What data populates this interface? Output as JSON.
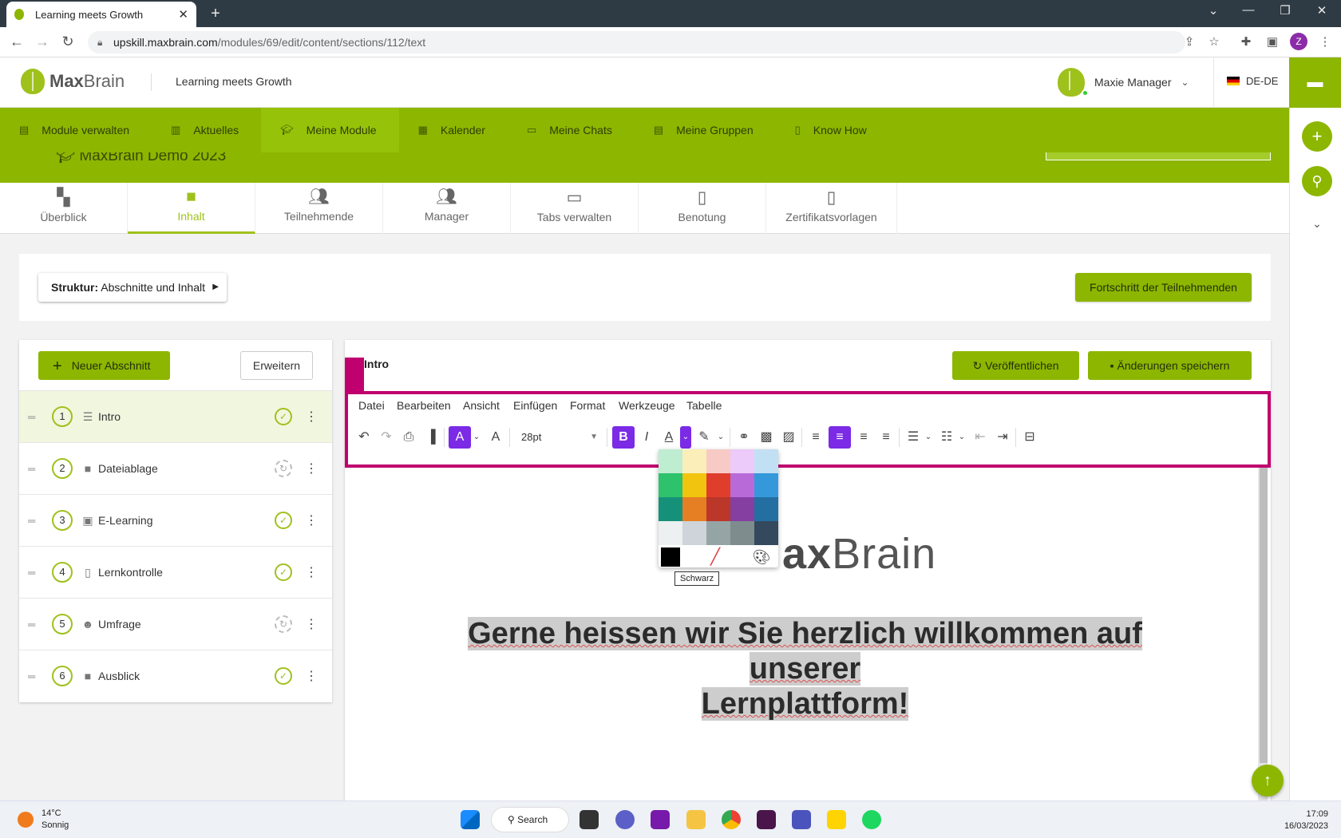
{
  "browser": {
    "tab_title": "Learning meets Growth",
    "url_host": "upskill.maxbrain.com",
    "url_path": "/modules/69/edit/content/sections/112/text",
    "profile_initial": "Z"
  },
  "header": {
    "logo_bold": "Max",
    "logo_light": "Brain",
    "tagline": "Learning meets Growth",
    "user_name": "Maxie Manager",
    "language": "DE-DE"
  },
  "mainnav": [
    {
      "label": "Module verwalten",
      "icon": "folder-icon"
    },
    {
      "label": "Aktuelles",
      "icon": "news-icon"
    },
    {
      "label": "Meine Module",
      "icon": "graduation-cap-icon",
      "active": true
    },
    {
      "label": "Kalender",
      "icon": "calendar-icon"
    },
    {
      "label": "Meine Chats",
      "icon": "chat-icon"
    },
    {
      "label": "Meine Gruppen",
      "icon": "group-icon"
    },
    {
      "label": "Know How",
      "icon": "book-icon"
    }
  ],
  "module_title": "MaxBrain Demo 2023",
  "module_tabs": [
    {
      "label": "Überblick",
      "icon": "dashboard-icon"
    },
    {
      "label": "Inhalt",
      "icon": "folder-icon",
      "active": true
    },
    {
      "label": "Teilnehmende",
      "icon": "people-icon"
    },
    {
      "label": "Manager",
      "icon": "manager-icon"
    },
    {
      "label": "Tabs verwalten",
      "icon": "window-icon"
    },
    {
      "label": "Benotung",
      "icon": "grade-icon"
    },
    {
      "label": "Zertifikatsvorlagen",
      "icon": "certificate-icon"
    }
  ],
  "structure": {
    "label": "Struktur:",
    "value": "Abschnitte und Inhalt"
  },
  "progress_button": "Fortschritt der Teilnehmenden",
  "sections_panel": {
    "new_button": "Neuer Abschnitt",
    "expand_button": "Erweitern",
    "items": [
      {
        "num": "1",
        "label": "Intro",
        "icon": "text-lines-icon",
        "status": "published",
        "active": true
      },
      {
        "num": "2",
        "label": "Dateiablage",
        "icon": "folder-icon",
        "status": "pending"
      },
      {
        "num": "3",
        "label": "E-Learning",
        "icon": "elearning-icon",
        "status": "published"
      },
      {
        "num": "4",
        "label": "Lernkontrolle",
        "icon": "quiz-icon",
        "status": "published"
      },
      {
        "num": "5",
        "label": "Umfrage",
        "icon": "survey-icon",
        "status": "pending"
      },
      {
        "num": "6",
        "label": "Ausblick",
        "icon": "folder-icon",
        "status": "published"
      }
    ]
  },
  "editor": {
    "section_title": "Intro",
    "publish_button": "Veröffentlichen",
    "save_button": "Änderungen speichern",
    "menu": [
      "Datei",
      "Bearbeiten",
      "Ansicht",
      "Einfügen",
      "Format",
      "Werkzeuge",
      "Tabelle"
    ],
    "font_size": "28pt",
    "logo_text_bold": "ax",
    "logo_text_light": "Brain",
    "content_line1": "Gerne heissen wir Sie herzlich willkommen auf unserer",
    "content_line2": "Lernplattform!"
  },
  "color_picker": {
    "tooltip": "Schwarz",
    "rows": [
      [
        "#bfedd2",
        "#fbeeb8",
        "#f8cac6",
        "#eccafa",
        "#c2e0f4"
      ],
      [
        "#2dc26b",
        "#f1c40f",
        "#e03e2d",
        "#b96ad9",
        "#3598db"
      ],
      [
        "#169179",
        "#e67e23",
        "#ba372a",
        "#843fa1",
        "#236fa1"
      ],
      [
        "#ecf0f1",
        "#ced4d9",
        "#95a5a6",
        "#7e8c8d",
        "#34495e"
      ]
    ],
    "selected": "#000000"
  },
  "colors": {
    "accent": "#8db600",
    "highlight": "#c0006e",
    "toolbar_active": "#7b2ae6"
  },
  "taskbar": {
    "temperature": "14°C",
    "weather": "Sonnig",
    "search": "Search",
    "time": "17:09",
    "date": "16/03/2023"
  }
}
